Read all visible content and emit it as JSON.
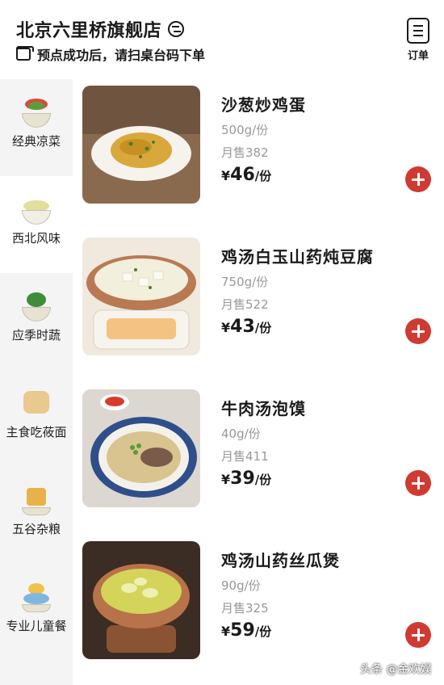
{
  "header": {
    "store_name": "北京六里桥旗舰店",
    "notice": "预点成功后，请扫桌台码下单",
    "order_label": "订单"
  },
  "sidebar": {
    "items": [
      {
        "label": "经典凉菜",
        "active": false
      },
      {
        "label": "西北风味",
        "active": true
      },
      {
        "label": "应季时蔬",
        "active": false
      },
      {
        "label": "主食吃莜面",
        "active": false
      },
      {
        "label": "五谷杂粮",
        "active": false
      },
      {
        "label": "专业儿童餐",
        "active": false
      }
    ]
  },
  "menu": {
    "items": [
      {
        "name": "沙葱炒鸡蛋",
        "weight": "500g/份",
        "sales": "月售382",
        "price_symbol": "¥",
        "price": "46",
        "price_unit": "/份"
      },
      {
        "name": "鸡汤白玉山药炖豆腐",
        "weight": "750g/份",
        "sales": "月售522",
        "price_symbol": "¥",
        "price": "43",
        "price_unit": "/份"
      },
      {
        "name": "牛肉汤泡馍",
        "weight": "40g/份",
        "sales": "月售411",
        "price_symbol": "¥",
        "price": "39",
        "price_unit": "/份"
      },
      {
        "name": "鸡汤山药丝瓜煲",
        "weight": "90g/份",
        "sales": "月售325",
        "price_symbol": "¥",
        "price": "59",
        "price_unit": "/份"
      }
    ]
  },
  "watermark": "头条 @金欢娱",
  "colors": {
    "accent": "#cf3a33",
    "sidebar_bg": "#f4f4f4",
    "muted_text": "#999999"
  }
}
